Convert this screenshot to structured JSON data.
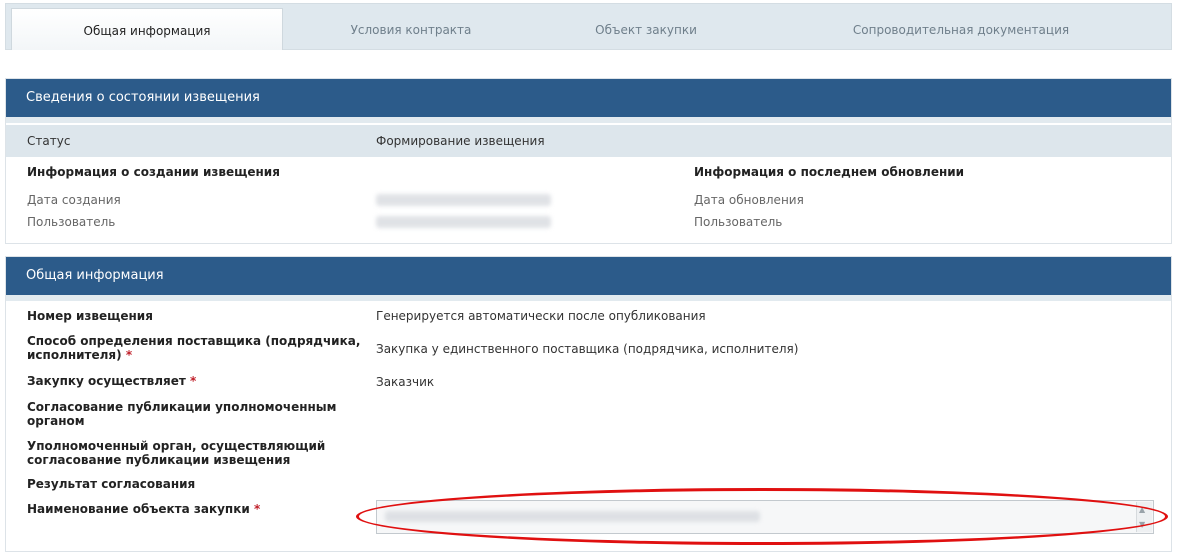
{
  "tabs": [
    {
      "label": "Общая информация",
      "active": true
    },
    {
      "label": "Условия контракта",
      "active": false
    },
    {
      "label": "Объект закупки",
      "active": false
    },
    {
      "label": "Сопроводительная документация",
      "active": false
    }
  ],
  "status_section": {
    "title": "Сведения о состоянии извещения",
    "status_label": "Статус",
    "status_value": "Формирование извещения",
    "created_heading": "Информация о создании извещения",
    "created_date_label": "Дата создания",
    "created_user_label": "Пользователь",
    "updated_heading": "Информация о последнем обновлении",
    "updated_date_label": "Дата обновления",
    "updated_user_label": "Пользователь"
  },
  "general_section": {
    "title": "Общая информация",
    "notice_number_label": "Номер извещения",
    "notice_number_value": "Генерируется автоматически после опубликования",
    "method_label_line1": "Способ определения поставщика (подрядчика,",
    "method_label_line2": "исполнителя)",
    "method_value": "Закупка у единственного поставщика (подрядчика, исполнителя)",
    "performer_label": "Закупку осуществляет",
    "performer_value": "Заказчик",
    "approval_label_line1": "Согласование публикации уполномоченным",
    "approval_label_line2": "органом",
    "authority_label_line1": "Уполномоченный орган, осуществляющий",
    "authority_label_line2": "согласование публикации извещения",
    "result_label": "Результат согласования",
    "object_name_label": "Наименование объекта закупки",
    "required_mark": "*"
  },
  "colors": {
    "header_bg": "#2c5b8a",
    "required": "#c0202a",
    "highlight_oval": "#e01010"
  }
}
